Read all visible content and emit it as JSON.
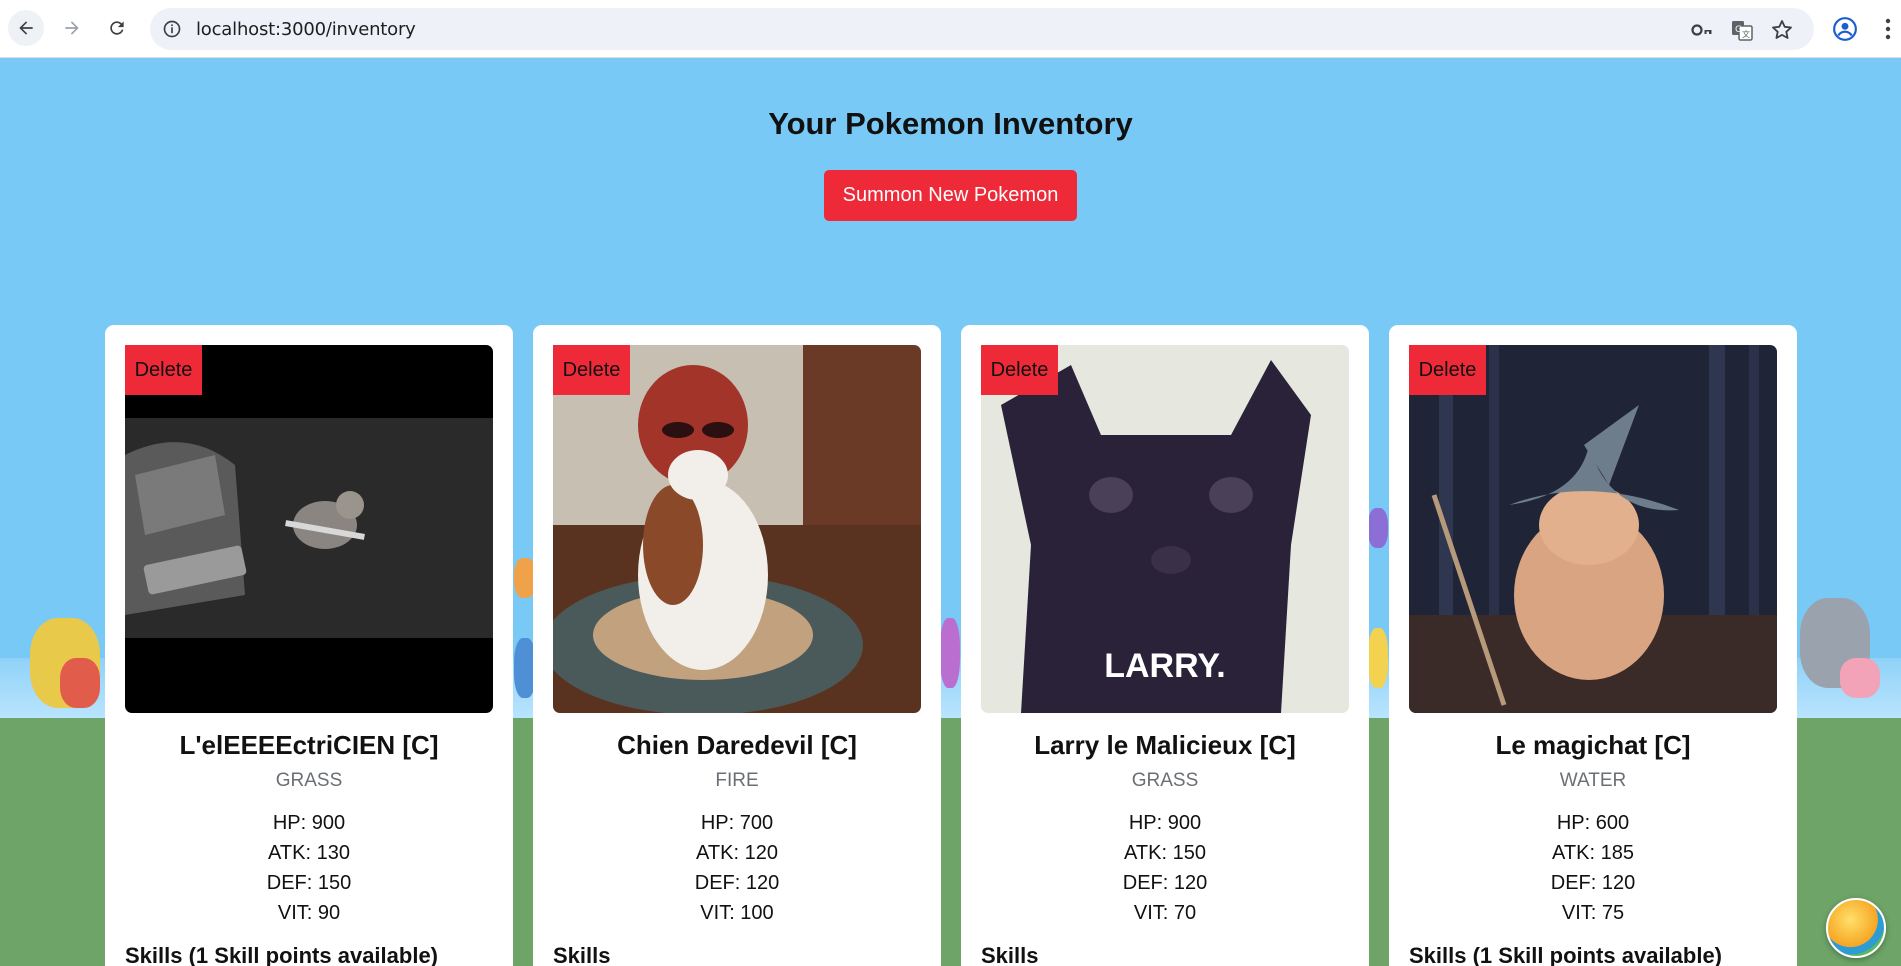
{
  "browser": {
    "url": "localhost:3000/inventory"
  },
  "page": {
    "title": "Your Pokemon Inventory",
    "summon_label": "Summon New Pokemon"
  },
  "cards": [
    {
      "delete_label": "Delete",
      "name": "L'elEEEEctriCIEN [C]",
      "type": "GRASS",
      "hp": "HP: 900",
      "atk": "ATK: 130",
      "def": "DEF: 150",
      "vit": "VIT: 90",
      "skills": "Skills (1 Skill points available)"
    },
    {
      "delete_label": "Delete",
      "name": "Chien Daredevil [C]",
      "type": "FIRE",
      "hp": "HP: 700",
      "atk": "ATK: 120",
      "def": "DEF: 120",
      "vit": "VIT: 100",
      "skills": "Skills"
    },
    {
      "delete_label": "Delete",
      "name": "Larry le Malicieux [C]",
      "type": "GRASS",
      "hp": "HP: 900",
      "atk": "ATK: 150",
      "def": "DEF: 120",
      "vit": "VIT: 70",
      "skills": "Skills",
      "image_caption": "LARRY."
    },
    {
      "delete_label": "Delete",
      "name": "Le magichat [C]",
      "type": "WATER",
      "hp": "HP: 600",
      "atk": "ATK: 185",
      "def": "DEF: 120",
      "vit": "VIT: 75",
      "skills": "Skills (1 Skill points available)"
    }
  ],
  "colors": {
    "accent_red": "#ee2a39",
    "sky": "#79c9f7",
    "grass": "#6ea468"
  }
}
